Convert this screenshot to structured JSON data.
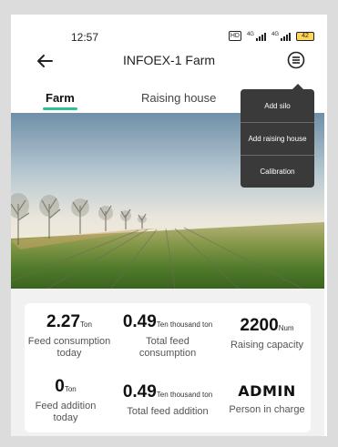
{
  "status_bar": {
    "time": "12:57",
    "hd_badge": "HD",
    "signal1_label": "4G",
    "signal2_label": "4G",
    "battery": "42"
  },
  "app_bar": {
    "title": "INFOEX-1 Farm"
  },
  "tabs": [
    {
      "label": "Farm",
      "active": true
    },
    {
      "label": "Raising house",
      "active": false
    }
  ],
  "menu": {
    "items": [
      "Add silo",
      "Add raising house",
      "Calibration"
    ]
  },
  "stats": [
    {
      "value": "2.27",
      "unit": "Ton",
      "label": "Feed consumption today"
    },
    {
      "value": "0.49",
      "unit": "Ten thousand ton",
      "label": "Total feed consumption"
    },
    {
      "value": "2200",
      "unit": "Num",
      "label": "Raising capacity"
    },
    {
      "value": "0",
      "unit": "Ton",
      "label": "Feed addition today"
    },
    {
      "value": "0.49",
      "unit": "Ten thousand ton",
      "label": "Total feed addition"
    },
    {
      "value": "ADMIN",
      "unit": "",
      "label": "Person in charge"
    }
  ],
  "colors": {
    "accent": "#2fbf95",
    "menu_bg": "#3a3a3a",
    "battery": "#ffd55c"
  },
  "icons": {
    "back": "back-arrow-icon",
    "menu": "menu-lines-icon"
  }
}
